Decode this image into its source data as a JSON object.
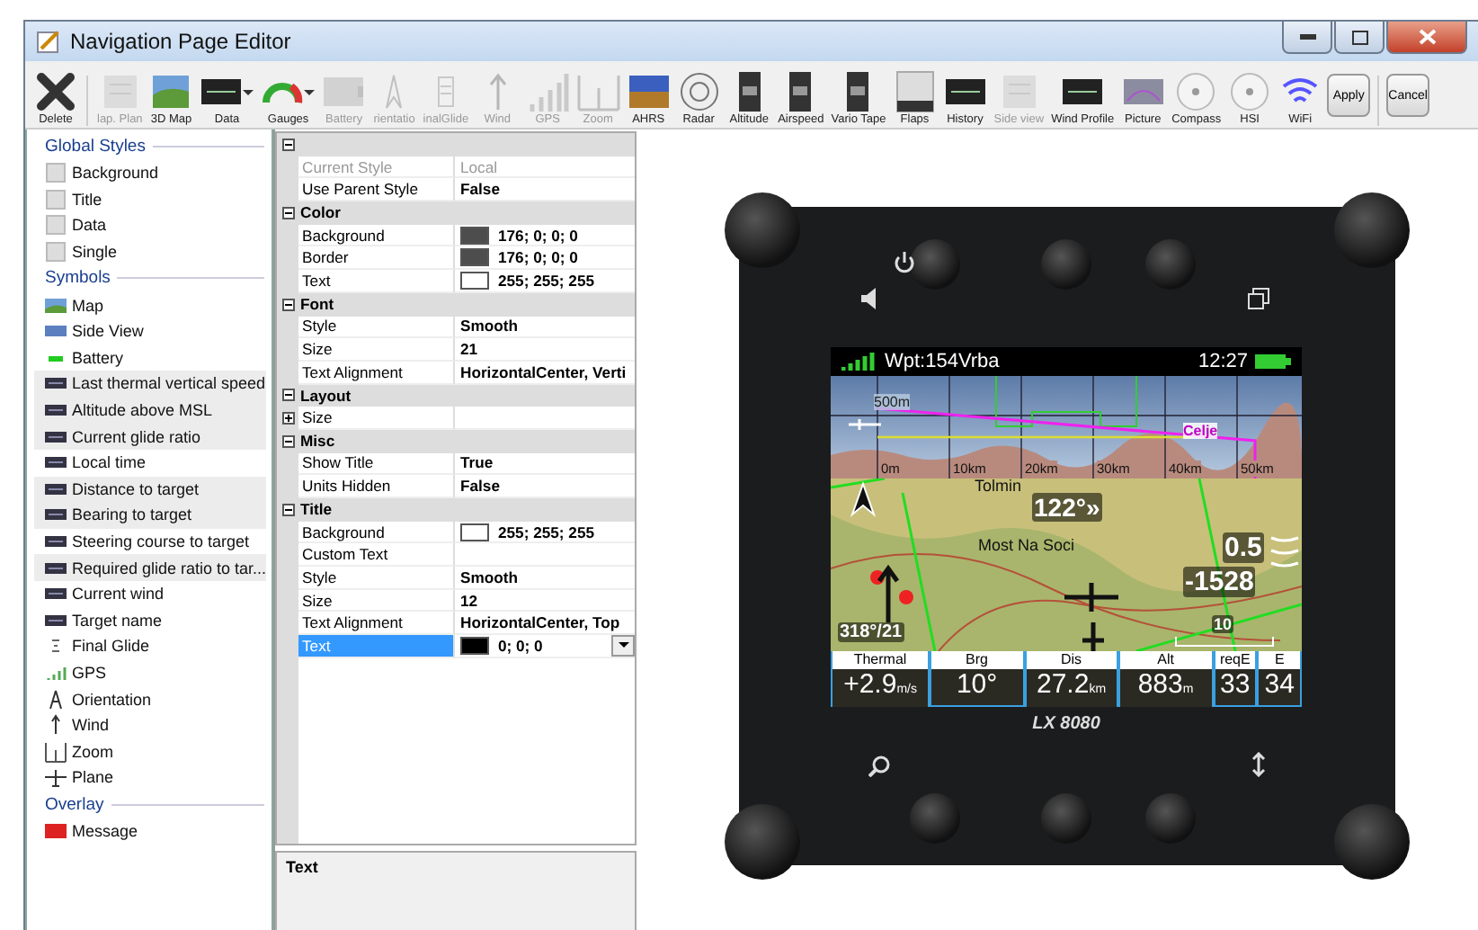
{
  "window": {
    "title": "Navigation Page Editor"
  },
  "toolbar": [
    {
      "label": "Delete",
      "kind": "cross",
      "disabled": false,
      "dropdown": false
    },
    {
      "label": "lap. Plan",
      "kind": "plan",
      "disabled": true,
      "dropdown": false
    },
    {
      "label": "3D Map",
      "kind": "map",
      "disabled": false,
      "dropdown": false
    },
    {
      "label": "Data",
      "kind": "data",
      "disabled": false,
      "dropdown": true
    },
    {
      "label": "Gauges",
      "kind": "gauge",
      "disabled": false,
      "dropdown": true
    },
    {
      "label": "Battery",
      "kind": "battery",
      "disabled": true,
      "dropdown": false
    },
    {
      "label": "rientatio",
      "kind": "needle",
      "disabled": true,
      "dropdown": false
    },
    {
      "label": "inalGlide",
      "kind": "glide",
      "disabled": true,
      "dropdown": false
    },
    {
      "label": "Wind",
      "kind": "arrow",
      "disabled": true,
      "dropdown": false
    },
    {
      "label": "GPS",
      "kind": "signal",
      "disabled": true,
      "dropdown": false
    },
    {
      "label": "Zoom",
      "kind": "zoom",
      "disabled": true,
      "dropdown": false
    },
    {
      "label": "AHRS",
      "kind": "horizon",
      "disabled": false,
      "dropdown": false
    },
    {
      "label": "Radar",
      "kind": "radar",
      "disabled": false,
      "dropdown": false
    },
    {
      "label": "Altitude",
      "kind": "tape",
      "disabled": false,
      "dropdown": false
    },
    {
      "label": "Airspeed",
      "kind": "tape",
      "disabled": false,
      "dropdown": false
    },
    {
      "label": "Vario Tape",
      "kind": "tape",
      "disabled": false,
      "dropdown": false
    },
    {
      "label": "Flaps",
      "kind": "flaps",
      "disabled": false,
      "dropdown": false
    },
    {
      "label": "History",
      "kind": "data",
      "disabled": false,
      "dropdown": false
    },
    {
      "label": "Side view",
      "kind": "plan",
      "disabled": true,
      "dropdown": false
    },
    {
      "label": "Wind Profile",
      "kind": "data",
      "disabled": false,
      "dropdown": false
    },
    {
      "label": "Picture",
      "kind": "picture",
      "disabled": false,
      "dropdown": false
    },
    {
      "label": "Compass",
      "kind": "dial",
      "disabled": false,
      "dropdown": false
    },
    {
      "label": "HSI",
      "kind": "dial",
      "disabled": false,
      "dropdown": false
    },
    {
      "label": "WiFi",
      "kind": "wifi",
      "disabled": false,
      "dropdown": false
    }
  ],
  "buttons": [
    "Apply",
    "Cancel"
  ],
  "styles_panel": [
    {
      "title": "Global Styles",
      "items": [
        {
          "label": "Background",
          "kind": "style",
          "selected": false
        },
        {
          "label": "Title",
          "kind": "style",
          "selected": false
        },
        {
          "label": "Data",
          "kind": "style",
          "selected": false
        },
        {
          "label": "Single",
          "kind": "style",
          "selected": false
        }
      ]
    },
    {
      "title": "Symbols",
      "items": [
        {
          "label": "Map",
          "kind": "map",
          "selected": false
        },
        {
          "label": "Side View",
          "kind": "side",
          "selected": false
        },
        {
          "label": "Battery",
          "kind": "battery",
          "selected": false
        },
        {
          "label": "Last thermal vertical speed",
          "kind": "data",
          "selected": true
        },
        {
          "label": "Altitude above MSL",
          "kind": "data",
          "selected": true
        },
        {
          "label": "Current glide ratio",
          "kind": "data",
          "selected": true
        },
        {
          "label": "Local time",
          "kind": "data",
          "selected": false
        },
        {
          "label": "Distance to target",
          "kind": "data",
          "selected": true
        },
        {
          "label": "Bearing to target",
          "kind": "data",
          "selected": true
        },
        {
          "label": "Steering course to target",
          "kind": "data",
          "selected": false
        },
        {
          "label": "Required glide ratio to tar...",
          "kind": "data",
          "selected": true
        },
        {
          "label": "Current wind",
          "kind": "data",
          "selected": false
        },
        {
          "label": "Target name",
          "kind": "data",
          "selected": false
        },
        {
          "label": "Final Glide",
          "kind": "glide",
          "selected": false
        },
        {
          "label": "GPS",
          "kind": "signal",
          "selected": false
        },
        {
          "label": "Orientation",
          "kind": "needle",
          "selected": false
        },
        {
          "label": "Wind",
          "kind": "arrow",
          "selected": false
        },
        {
          "label": "Zoom",
          "kind": "zoom",
          "selected": false
        },
        {
          "label": "Plane",
          "kind": "plane",
          "selected": false
        }
      ]
    },
    {
      "title": "Overlay",
      "items": [
        {
          "label": "Message",
          "kind": "message",
          "selected": false
        }
      ]
    }
  ],
  "properties": [
    {
      "expanded": true,
      "rows": [
        {
          "kind": "property",
          "name": "Current Style",
          "value": "Local",
          "disabled": true,
          "selected": false
        },
        {
          "kind": "property",
          "name": "Use Parent Style",
          "value": "False",
          "disabled": false,
          "selected": false
        }
      ]
    },
    {
      "title": "Color",
      "expanded": true,
      "rows": [
        {
          "kind": "property",
          "name": "Background",
          "value": "176; 0; 0; 0",
          "color": "#4d4d4d",
          "disabled": false,
          "selected": false
        },
        {
          "kind": "property",
          "name": "Border",
          "value": "176; 0; 0; 0",
          "color": "#4d4d4d",
          "disabled": false,
          "selected": false
        },
        {
          "kind": "property",
          "name": "Text",
          "value": "255; 255; 255",
          "color": "#ffffff",
          "disabled": false,
          "selected": false
        }
      ]
    },
    {
      "title": "Font",
      "expanded": true,
      "rows": [
        {
          "kind": "property",
          "name": "Style",
          "value": "Smooth",
          "disabled": false,
          "selected": false
        },
        {
          "kind": "property",
          "name": "Size",
          "value": "21",
          "disabled": false,
          "selected": false
        },
        {
          "kind": "property",
          "name": "Text Alignment",
          "value": "HorizontalCenter, Verti",
          "disabled": false,
          "selected": false
        }
      ]
    },
    {
      "title": "Layout",
      "expanded": true,
      "rows": [
        {
          "kind": "subgroup",
          "name": "Size",
          "disabled": false,
          "selected": false
        }
      ]
    },
    {
      "title": "Misc",
      "expanded": true,
      "rows": [
        {
          "kind": "property",
          "name": "Show Title",
          "value": "True",
          "disabled": false,
          "selected": false
        },
        {
          "kind": "property",
          "name": "Units Hidden",
          "value": "False",
          "disabled": false,
          "selected": false
        }
      ]
    },
    {
      "title": "Title",
      "expanded": true,
      "rows": [
        {
          "kind": "property",
          "name": "Background",
          "value": "255; 255; 255",
          "color": "#ffffff",
          "disabled": false,
          "selected": false
        },
        {
          "kind": "property",
          "name": "Custom Text",
          "disabled": false,
          "selected": false
        },
        {
          "kind": "property",
          "name": "Style",
          "value": "Smooth",
          "disabled": false,
          "selected": false
        },
        {
          "kind": "property",
          "name": "Size",
          "value": "12",
          "disabled": false,
          "selected": false
        },
        {
          "kind": "property",
          "name": "Text Alignment",
          "value": "HorizontalCenter, Top",
          "disabled": false,
          "selected": false
        },
        {
          "kind": "property",
          "name": "Text",
          "value": "0; 0; 0",
          "color": "#000000",
          "disabled": false,
          "selected": true
        }
      ]
    }
  ],
  "description": {
    "title": "Text"
  },
  "device": {
    "brand": "LX 8080",
    "status": {
      "waypoint": "Wpt:154Vrba",
      "time": "12:27"
    },
    "profile": {
      "altitude": "500m",
      "place": "Celje",
      "distances": [
        "0m",
        "10km",
        "20km",
        "30km",
        "40km",
        "50km"
      ]
    },
    "map": {
      "towns": [
        "Tolmin",
        "Most Na Soci"
      ],
      "track": "122°»",
      "vario": "0.5",
      "altitude": "-1528",
      "wind": "318°/21",
      "scale": "10"
    },
    "fields": [
      {
        "title": "Thermal",
        "value": "+2.9",
        "unit": "m/s"
      },
      {
        "title": "Brg",
        "value": "10°"
      },
      {
        "title": "Dis",
        "value": "27.2",
        "unit": "km"
      },
      {
        "title": "Alt",
        "value": "883",
        "unit": "m"
      },
      {
        "title": "reqE",
        "value": "33"
      },
      {
        "title": "E",
        "value": "34"
      }
    ]
  }
}
